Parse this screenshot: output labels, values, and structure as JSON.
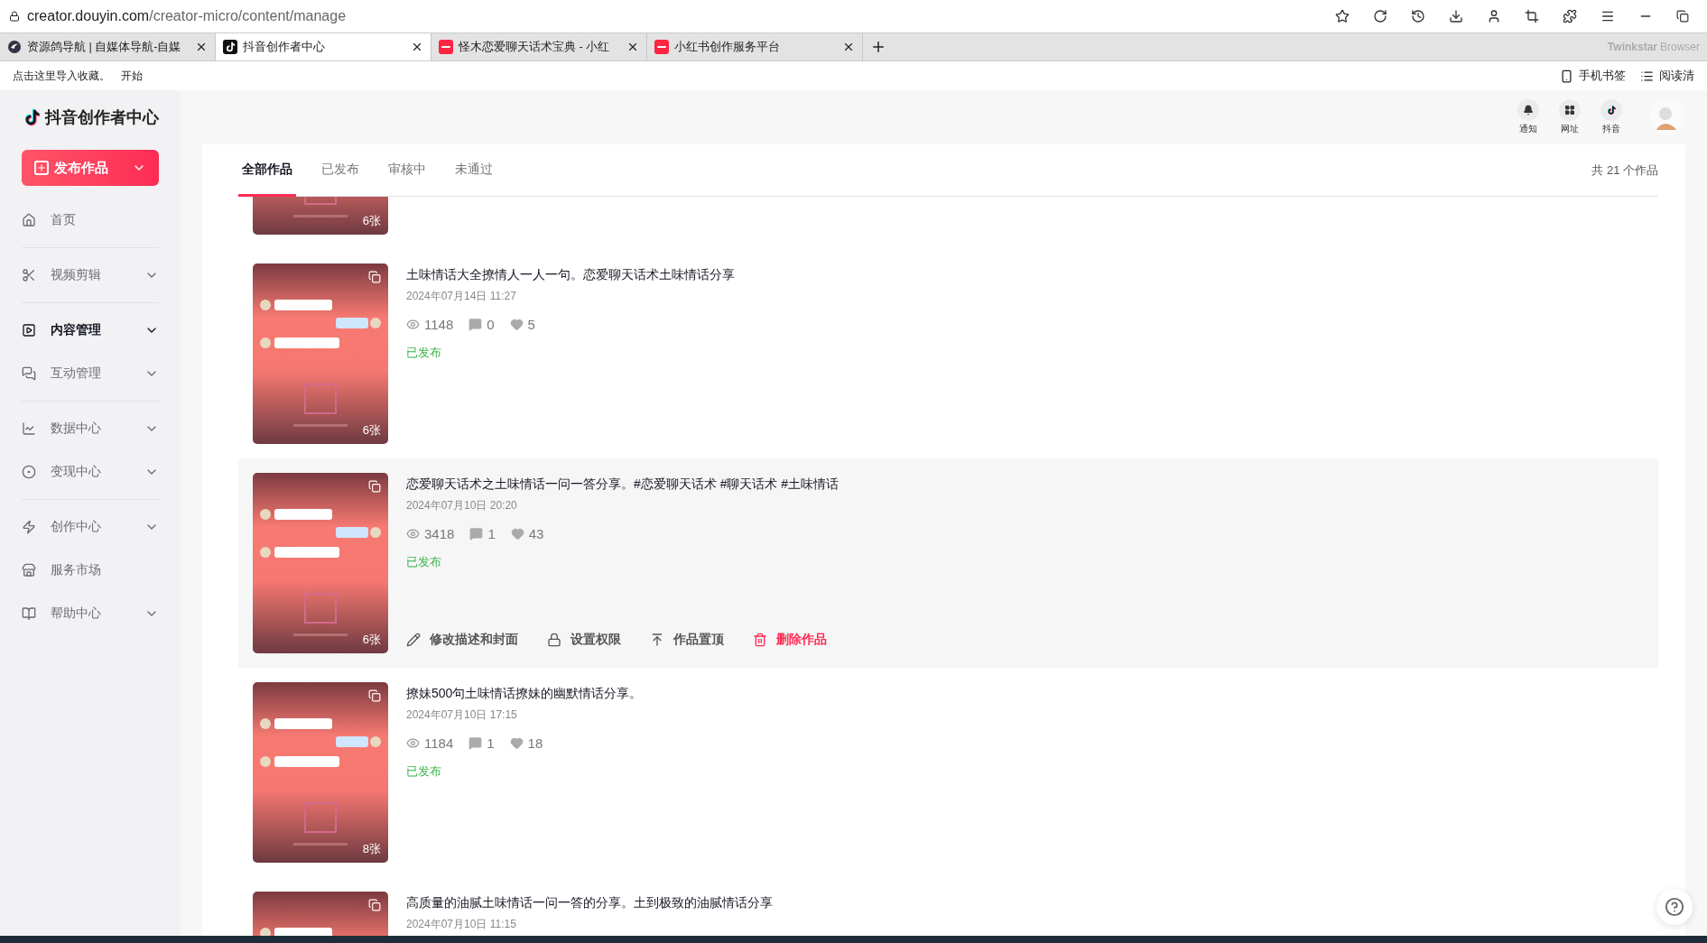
{
  "browser": {
    "address": {
      "host": "creator.douyin.com",
      "path": "/creator-micro/content/manage"
    },
    "tabs": [
      {
        "label": "资源鸽导航 | 自媒体导航-自媒",
        "kind": "bird",
        "selected": false
      },
      {
        "label": "抖音创作者中心",
        "kind": "tiktok",
        "selected": true
      },
      {
        "label": "怪木恋爱聊天话术宝典 - 小红",
        "kind": "redbook",
        "selected": false
      },
      {
        "label": "小红书创作服务平台",
        "kind": "redbook",
        "selected": false
      }
    ],
    "brand": {
      "bold": "Twinkstar",
      "light": "Browser"
    },
    "bookmarks": {
      "hint": "点击这里导入收藏。",
      "start": "开始",
      "right": [
        {
          "label": "手机书签",
          "kind": "phone"
        },
        {
          "label": "阅读清",
          "kind": "list"
        }
      ]
    }
  },
  "sidebar": {
    "logo": "抖音创作者中心",
    "publish": "发布作品",
    "groups": [
      [
        {
          "label": "首页",
          "kind": "home",
          "expandable": false,
          "selected": false
        }
      ],
      [
        {
          "label": "视频剪辑",
          "kind": "scissors",
          "expandable": true,
          "selected": false
        }
      ],
      [
        {
          "label": "内容管理",
          "kind": "play",
          "expandable": true,
          "selected": true
        },
        {
          "label": "互动管理",
          "kind": "chat",
          "expandable": true,
          "selected": false
        }
      ],
      [
        {
          "label": "数据中心",
          "kind": "chart",
          "expandable": true,
          "selected": false
        },
        {
          "label": "变现中心",
          "kind": "coin",
          "expandable": true,
          "selected": false
        }
      ],
      [
        {
          "label": "创作中心",
          "kind": "bolt",
          "expandable": true,
          "selected": false
        },
        {
          "label": "服务市场",
          "kind": "shop",
          "expandable": false,
          "selected": false
        },
        {
          "label": "帮助中心",
          "kind": "book",
          "expandable": true,
          "selected": false
        }
      ]
    ]
  },
  "header": {
    "shortcuts": [
      {
        "label": "通知",
        "kind": "bell"
      },
      {
        "label": "网址",
        "kind": "grid"
      },
      {
        "label": "抖音",
        "kind": "tiktok"
      }
    ]
  },
  "tabs": [
    {
      "label": "全部作品",
      "selected": true
    },
    {
      "label": "已发布",
      "selected": false
    },
    {
      "label": "审核中",
      "selected": false
    },
    {
      "label": "未通过",
      "selected": false
    }
  ],
  "total": "共 21 个作品",
  "works": [
    {
      "kind": "partial",
      "count": "6张"
    },
    {
      "kind": "full",
      "title": "土味情话大全撩情人一人一句。恋爱聊天话术土味情话分享",
      "date": "2024年07月14日 11:27",
      "views": "1148",
      "comments": "0",
      "likes": "5",
      "status": "已发布",
      "count": "6张"
    },
    {
      "kind": "full",
      "title": "恋爱聊天话术之土味情话一问一答分享。#恋爱聊天话术 #聊天话术 #土味情话",
      "date": "2024年07月10日 20:20",
      "views": "3418",
      "comments": "1",
      "likes": "43",
      "status": "已发布",
      "count": "6张",
      "actions": [
        {
          "label": "修改描述和封面",
          "kind": "pencil",
          "danger": false
        },
        {
          "label": "设置权限",
          "kind": "lock",
          "danger": false
        },
        {
          "label": "作品置顶",
          "kind": "pin",
          "danger": false
        },
        {
          "label": "删除作品",
          "kind": "trash",
          "danger": true
        }
      ]
    },
    {
      "kind": "full",
      "title": "撩妹500句土味情话撩妹的幽默情话分享。",
      "date": "2024年07月10日 17:15",
      "views": "1184",
      "comments": "1",
      "likes": "18",
      "status": "已发布",
      "count": "8张"
    },
    {
      "kind": "full",
      "title": "高质量的油腻土味情话一问一答的分享。土到极致的油腻情话分享",
      "date": "2024年07月10日 11:15"
    }
  ]
}
